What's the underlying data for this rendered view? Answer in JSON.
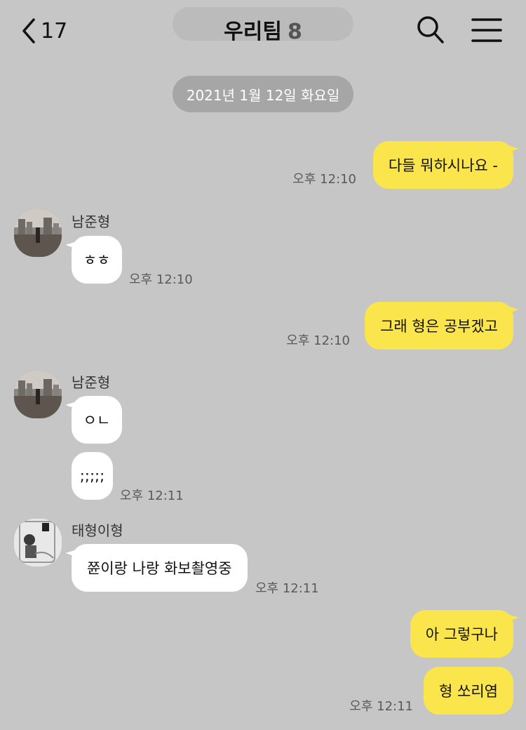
{
  "header": {
    "back_count": "17",
    "title": "우리팀",
    "member_count": "8"
  },
  "date_divider": "2021년 1월 12일 화요일",
  "messages": [
    {
      "text": "다들 뭐하시나요 -",
      "time": "오후 12:10"
    },
    {
      "sender": "남준형",
      "text": "ㅎㅎ",
      "time": "오후 12:10"
    },
    {
      "text": "그래 형은 공부겠고",
      "time": "오후 12:10"
    },
    {
      "sender": "남준형",
      "text": "ㅇㄴ"
    },
    {
      "text": ";;;;;",
      "time": "오후 12:11"
    },
    {
      "sender": "태형이형",
      "text": "쮼이랑 나랑 화보촬영중",
      "time": "오후 12:11"
    },
    {
      "text": "아 그렇구나"
    },
    {
      "text": "형 쏘리염",
      "time": "오후 12:11"
    }
  ],
  "colors": {
    "background": "#c6c6c6",
    "my_bubble": "#fbe54d",
    "their_bubble": "#ffffff",
    "date_pill": "#a6a6a6"
  },
  "icons": [
    "back-chevron-icon",
    "search-icon",
    "hamburger-menu-icon"
  ]
}
